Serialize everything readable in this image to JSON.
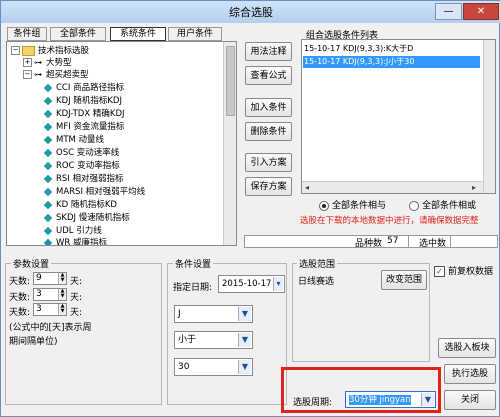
{
  "window": {
    "title": "综合选股",
    "minimize_icon": "minimize-icon",
    "close_icon": "close-icon"
  },
  "tabs": [
    {
      "label": "条件组"
    },
    {
      "label": "全部条件"
    },
    {
      "label": "系统条件",
      "active": true
    },
    {
      "label": "用户条件"
    }
  ],
  "tree": [
    {
      "label": "技术指标选股",
      "level": 0,
      "type": "folder",
      "expander": "−"
    },
    {
      "label": "大势型",
      "level": 1,
      "type": "branch",
      "expander": "+"
    },
    {
      "label": "超买超卖型",
      "level": 1,
      "type": "branch",
      "expander": "−"
    },
    {
      "label": "CCI 商品路径指标",
      "level": 2,
      "type": "leaf"
    },
    {
      "label": "KDJ 随机指标KDJ",
      "level": 2,
      "type": "leaf"
    },
    {
      "label": "KDJ-TDX 精确KDJ",
      "level": 2,
      "type": "leaf"
    },
    {
      "label": "MFI 资金流量指标",
      "level": 2,
      "type": "leaf"
    },
    {
      "label": "MTM 动量线",
      "level": 2,
      "type": "leaf"
    },
    {
      "label": "OSC 变动速率线",
      "level": 2,
      "type": "leaf"
    },
    {
      "label": "ROC 变动率指标",
      "level": 2,
      "type": "leaf"
    },
    {
      "label": "RSI 相对强弱指标",
      "level": 2,
      "type": "leaf"
    },
    {
      "label": "MARSI 相对强弱平均线",
      "level": 2,
      "type": "leaf"
    },
    {
      "label": "KD 随机指标KD",
      "level": 2,
      "type": "leaf"
    },
    {
      "label": "SKDJ 慢速随机指标",
      "level": 2,
      "type": "leaf"
    },
    {
      "label": "UDL 引力线",
      "level": 2,
      "type": "leaf"
    },
    {
      "label": "WR 威廉指标",
      "level": 2,
      "type": "leaf"
    }
  ],
  "side_buttons": {
    "usage": "用法注释",
    "view_formula": "查看公式",
    "add": "加入条件",
    "delete": "删除条件",
    "import": "引入方案",
    "save": "保存方案"
  },
  "combo_list": {
    "title": "组合选股条件列表",
    "items": [
      {
        "text": "15-10-17 KDJ(9,3,3):K大于D",
        "selected": false
      },
      {
        "text": "15-10-17 KDJ(9,3,3):J小于30",
        "selected": true
      }
    ]
  },
  "logic": {
    "and_label": "全部条件相与",
    "or_label": "全部条件相或",
    "selected": "and"
  },
  "notice": "选股在下载的本地数据中进行，请确保数据完整",
  "counts": {
    "stock_label": "品种数",
    "stock_value": "57",
    "selected_label": "选中数"
  },
  "params": {
    "legend": "参数设置",
    "rows": [
      {
        "prefix": "天数:",
        "value": "9",
        "suffix": "天:"
      },
      {
        "prefix": "天数:",
        "value": "3",
        "suffix": "天:"
      },
      {
        "prefix": "天数:",
        "value": "3",
        "suffix": "天:"
      }
    ],
    "note": "(公式中的[天]表示周期间隔单位)"
  },
  "condition": {
    "legend": "条件设置",
    "date_label": "指定日期:",
    "date_value": "2015-10-17",
    "line": "J",
    "operator": "小于",
    "value": "30"
  },
  "range": {
    "legend": "选股范围",
    "value": "日线赛选",
    "change_button": "改变范围",
    "period_label": "选股周期:",
    "period_value": "30分钟 jingyan"
  },
  "right": {
    "prior_adjust_label": "前复权数据",
    "prior_adjust_checked": true,
    "to_board": "选股入板块",
    "execute": "执行选股",
    "close": "关闭"
  },
  "highlight_color": "#e0231b",
  "selected_row_color": "#3399ff"
}
